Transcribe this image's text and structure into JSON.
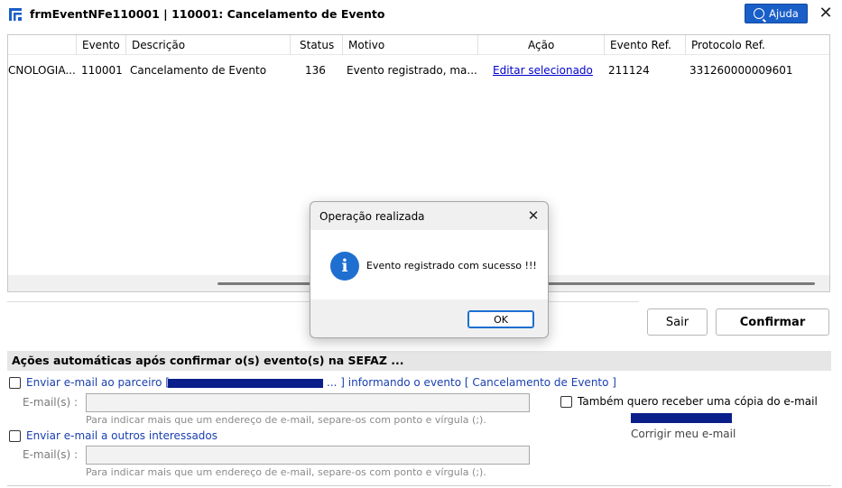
{
  "window": {
    "title": "frmEventNFe110001 | 110001: Cancelamento de Evento",
    "help_label": "Ajuda"
  },
  "grid": {
    "columns": [
      "Evento",
      "Descrição",
      "Status",
      "Motivo",
      "Ação",
      "Evento Ref.",
      "Protocolo Ref."
    ],
    "rows": [
      {
        "partner": "CNOLOGIA...",
        "evento": "110001",
        "descricao": "Cancelamento de Evento",
        "status": "136",
        "motivo": "Evento registrado, ma...",
        "acao": "Editar selecionado",
        "evento_ref": "211124",
        "protocolo_ref": "331260000009601"
      }
    ]
  },
  "buttons": {
    "sair": "Sair",
    "confirmar": "Confirmar"
  },
  "actions": {
    "header": "Ações automáticas após confirmar o(s) evento(s) na SEFAZ ...",
    "partner_email_prefix": "Enviar e-mail ao parceiro [",
    "partner_email_suffix": "... ] informando o evento [ Cancelamento de Evento ]",
    "emails_label": "E-mail(s) :",
    "hint": "Para indicar mais que um endereço de e-mail, separe-os com ponto e vírgula (;).",
    "copy_label": "Também quero receber uma cópia do e-mail",
    "corrigir": "Corrigir meu e-mail",
    "others_label": "Enviar e-mail a outros interessados",
    "emails_label_2": "E-mail(s) :",
    "hint_2": "Para indicar mais que um endereço de e-mail, separe-os com ponto e vírgula (;)."
  },
  "dialog": {
    "title": "Operação realizada",
    "message": "Evento registrado com sucesso !!!",
    "ok": "OK"
  },
  "colors": {
    "accent": "#1a5fc8",
    "link": "#0000cc",
    "redaction": "#0a1f8a",
    "info_icon": "#1f6fd1"
  }
}
